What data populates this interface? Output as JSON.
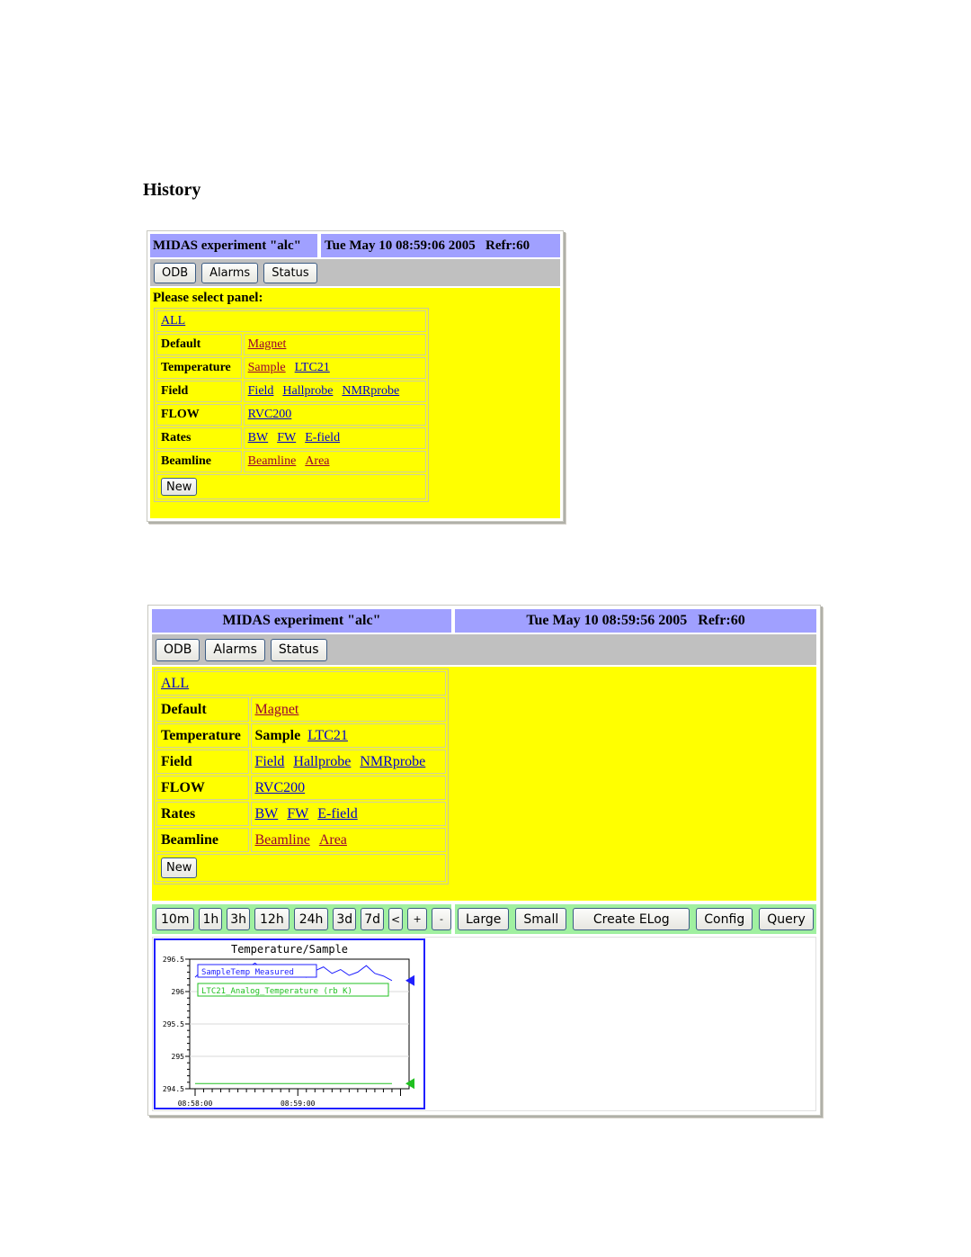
{
  "page": {
    "heading": "History"
  },
  "colors": {
    "header_bg": "#a0a0ff",
    "nav_bg": "#c0c0c0",
    "panel_bg": "#ffff00",
    "toolbar_bg": "#a0f0a0",
    "link": "#0000cc",
    "visited_link": "#990033"
  },
  "shot1": {
    "title": "MIDAS experiment \"alc\"",
    "datetime": "Tue May 10 08:59:06 2005   Refr:60",
    "nav": [
      "ODB",
      "Alarms",
      "Status"
    ],
    "prompt": "Please select panel:",
    "all_link": "ALL",
    "groups": [
      {
        "label": "Default",
        "items": [
          {
            "text": "Magnet",
            "visited": true
          }
        ]
      },
      {
        "label": "Temperature",
        "items": [
          {
            "text": "Sample",
            "visited": true
          },
          {
            "text": "LTC21"
          }
        ]
      },
      {
        "label": "Field",
        "items": [
          {
            "text": "Field"
          },
          {
            "text": "Hallprobe"
          },
          {
            "text": "NMRprobe"
          }
        ]
      },
      {
        "label": "FLOW",
        "items": [
          {
            "text": "RVC200"
          }
        ]
      },
      {
        "label": "Rates",
        "items": [
          {
            "text": "BW"
          },
          {
            "text": "FW"
          },
          {
            "text": "E-field"
          }
        ]
      },
      {
        "label": "Beamline",
        "items": [
          {
            "text": "Beamline",
            "visited": true
          },
          {
            "text": "Area",
            "visited": true
          }
        ]
      }
    ],
    "new_button": "New"
  },
  "shot2": {
    "title": "MIDAS experiment \"alc\"",
    "datetime": "Tue May 10 08:59:56 2005   Refr:60",
    "nav": [
      "ODB",
      "Alarms",
      "Status"
    ],
    "all_link": "ALL",
    "groups": [
      {
        "label": "Default",
        "items": [
          {
            "text": "Magnet",
            "visited": true
          }
        ]
      },
      {
        "label": "Temperature",
        "items": [
          {
            "text": "Sample",
            "current": true
          },
          {
            "text": "LTC21"
          }
        ]
      },
      {
        "label": "Field",
        "items": [
          {
            "text": "Field"
          },
          {
            "text": "Hallprobe"
          },
          {
            "text": "NMRprobe"
          }
        ]
      },
      {
        "label": "FLOW",
        "items": [
          {
            "text": "RVC200"
          }
        ]
      },
      {
        "label": "Rates",
        "items": [
          {
            "text": "BW"
          },
          {
            "text": "FW"
          },
          {
            "text": "E-field"
          }
        ]
      },
      {
        "label": "Beamline",
        "items": [
          {
            "text": "Beamline",
            "visited": true
          },
          {
            "text": "Area",
            "visited": true
          }
        ]
      }
    ],
    "new_button": "New",
    "time_buttons": [
      "10m",
      "1h",
      "3h",
      "12h",
      "24h",
      "3d",
      "7d",
      "<",
      "+",
      "-"
    ],
    "action_buttons": [
      "Large",
      "Small",
      "Create ELog",
      "Config",
      "Query"
    ]
  },
  "chart_data": {
    "type": "line",
    "title": "Temperature/Sample",
    "xlabel": "",
    "ylabel": "",
    "ylim": [
      294.5,
      296.5
    ],
    "yticks": [
      "296.5",
      "296",
      "295.5",
      "295",
      "294.5"
    ],
    "xticks": [
      "08:58:00",
      "08:59:00"
    ],
    "grid": true,
    "legend_position": "top-left",
    "series": [
      {
        "name": "SampleTemp Measured",
        "color": "#2020ff",
        "x_seconds_from_0858": [
          0,
          5,
          10,
          15,
          20,
          25,
          30,
          35,
          40,
          45,
          50,
          55,
          60,
          65,
          70,
          75,
          80,
          85,
          90,
          95,
          100,
          105,
          110,
          115
        ],
        "values": [
          296.22,
          296.35,
          296.38,
          296.4,
          296.37,
          296.42,
          296.36,
          296.44,
          296.34,
          296.28,
          296.37,
          296.3,
          296.35,
          296.22,
          296.32,
          296.38,
          296.28,
          296.34,
          296.25,
          296.3,
          296.4,
          296.28,
          296.24,
          296.17
        ]
      },
      {
        "name": "LTC21_Analog_Temperature (rb K)",
        "color": "#20c020",
        "x_seconds_from_0858": [
          0,
          115
        ],
        "values": [
          294.58,
          294.58
        ]
      }
    ]
  }
}
